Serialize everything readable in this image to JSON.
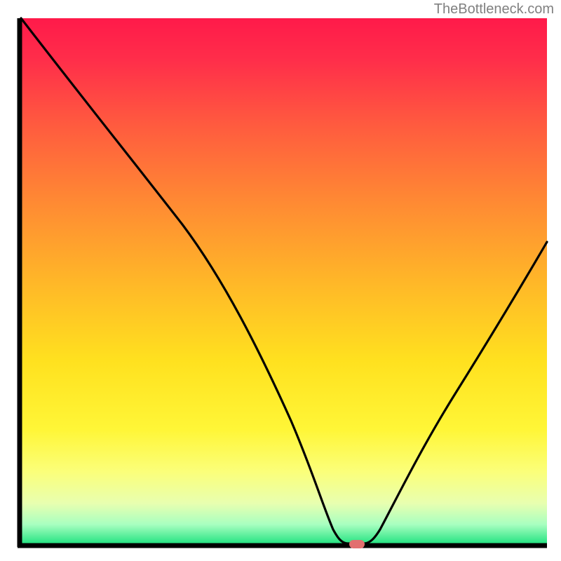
{
  "watermark": "TheBottleneck.com",
  "chart_data": {
    "type": "line",
    "title": "",
    "xlabel": "",
    "ylabel": "",
    "xlim": [
      0,
      100
    ],
    "ylim": [
      0,
      100
    ],
    "x": [
      0,
      10,
      20,
      30,
      40,
      50,
      55,
      58,
      60,
      62,
      65,
      70,
      80,
      90,
      100
    ],
    "y": [
      100,
      87,
      74,
      62,
      47,
      28,
      12,
      3,
      0,
      0,
      3,
      14,
      30,
      46,
      62
    ],
    "marker": {
      "x": 61,
      "y": 0
    },
    "background": "red-yellow-green-gradient",
    "series_color": "#000000",
    "axis_color": "#000000",
    "axis_width": 6
  }
}
